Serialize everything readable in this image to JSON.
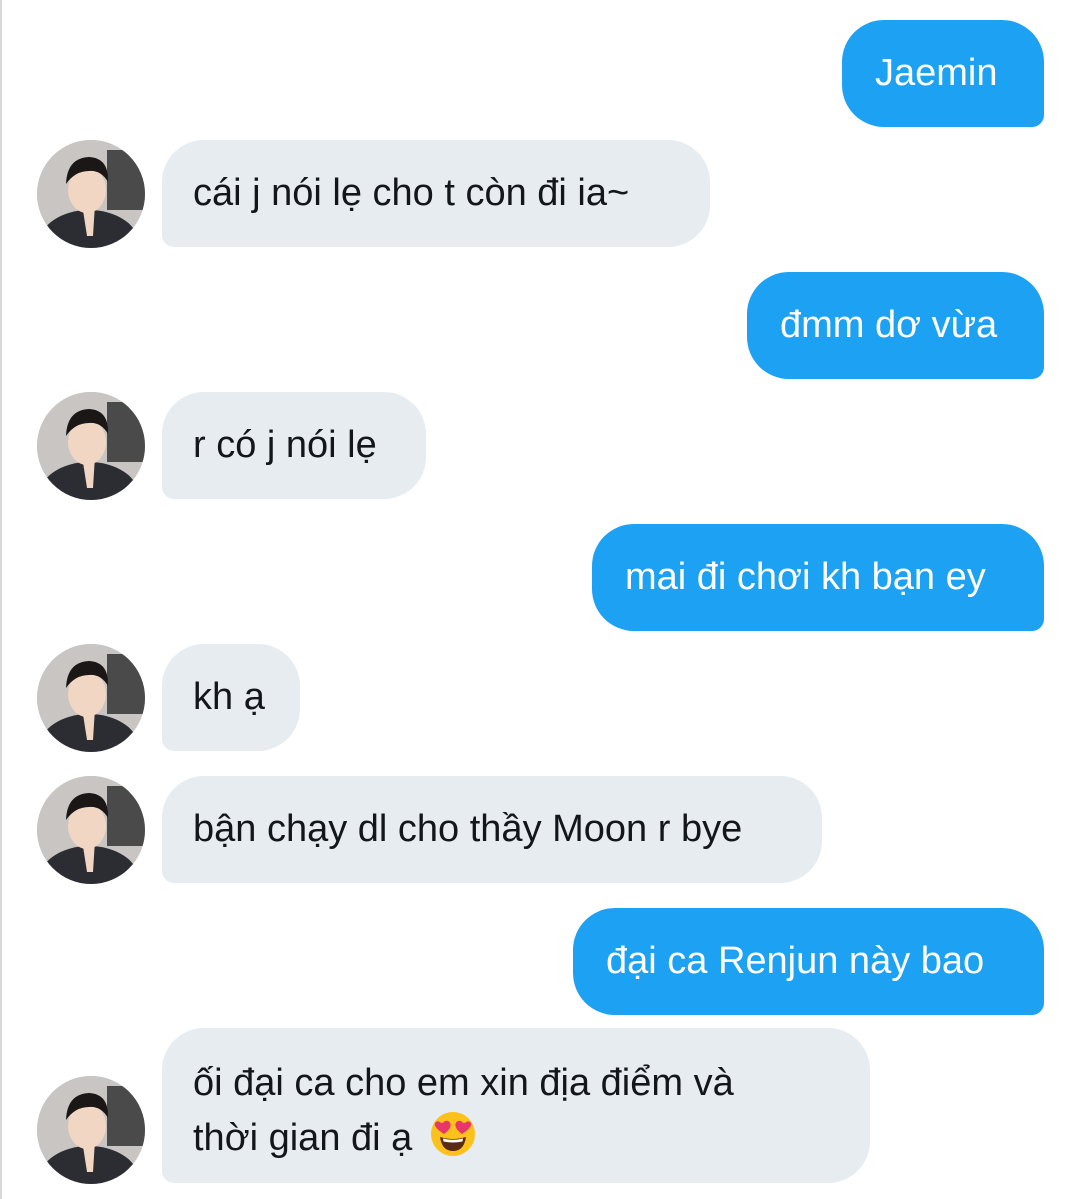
{
  "conversation": {
    "messages": [
      {
        "sender": "me",
        "text": "Jaemin"
      },
      {
        "sender": "them",
        "text": "cái j nói lẹ cho t còn đi ia~"
      },
      {
        "sender": "me",
        "text": "đmm dơ vừa"
      },
      {
        "sender": "them",
        "text": "r có j nói lẹ"
      },
      {
        "sender": "me",
        "text": "mai đi chơi kh bạn ey"
      },
      {
        "sender": "them",
        "text": "kh ạ"
      },
      {
        "sender": "them",
        "text": "bận chạy dl cho thầy Moon r bye"
      },
      {
        "sender": "me",
        "text": "đại ca Renjun này bao"
      },
      {
        "sender": "them",
        "text_line1": "ối đại ca cho em xin địa điểm và",
        "text_line2": "thời gian đi ạ",
        "emoji": "smiling-face-with-heart-eyes"
      }
    ]
  },
  "colors": {
    "outgoing_bubble": "#1da1f2",
    "incoming_bubble": "#e6ecf0",
    "incoming_text": "#14171a",
    "outgoing_text": "#ffffff"
  }
}
